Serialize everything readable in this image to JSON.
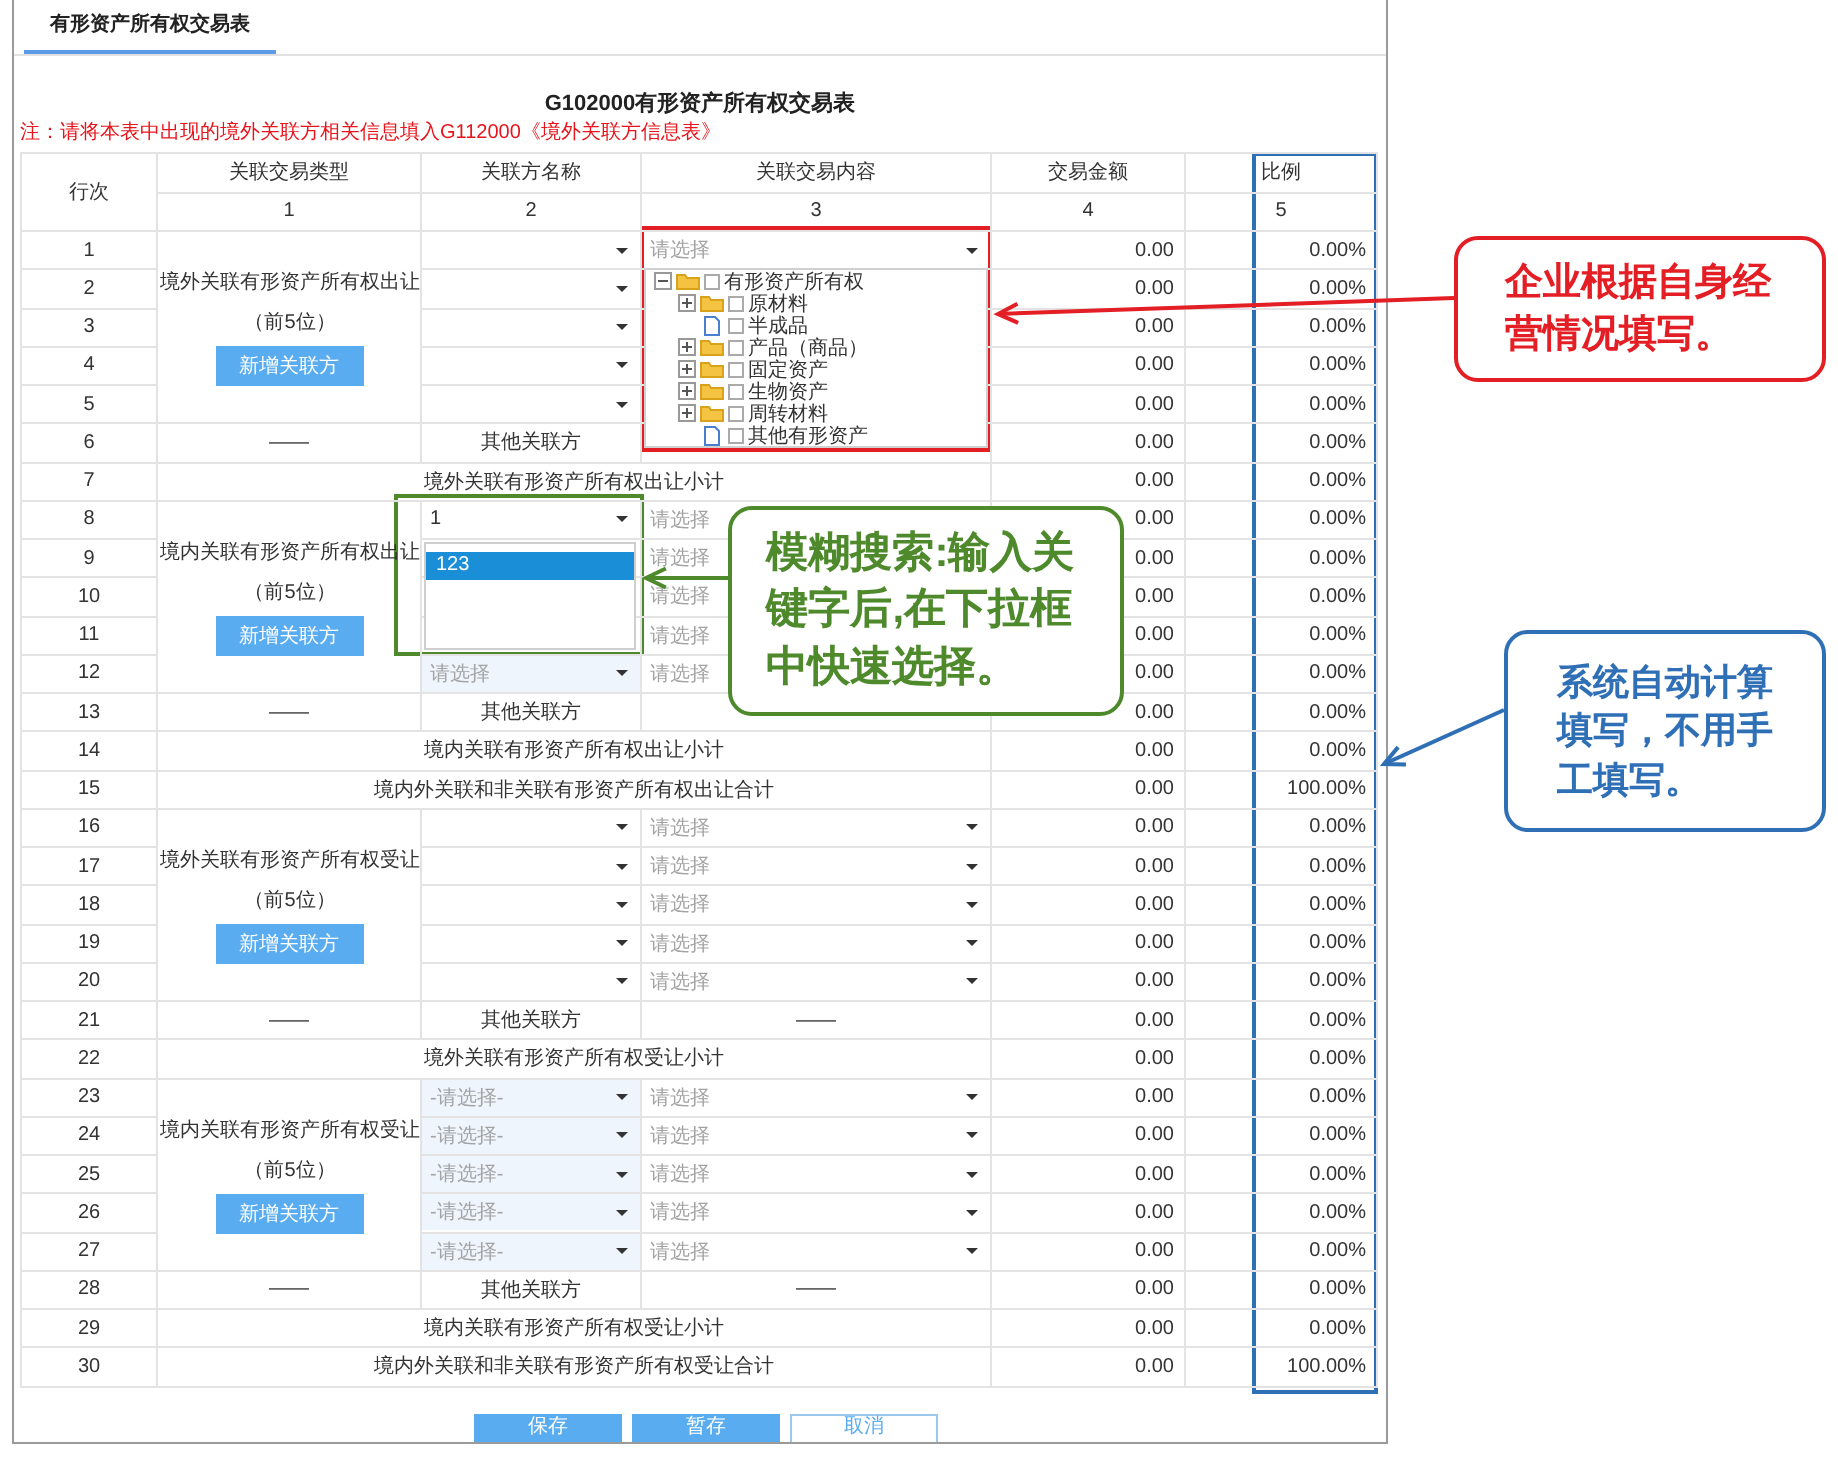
{
  "tab": {
    "label": "有形资产所有权交易表",
    "selected": true
  },
  "title": "G102000有形资产所有权交易表",
  "note": "注：请将本表中出现的境外关联方相关信息填入G112000《境外关联方信息表》",
  "table": {
    "row_no_header": "行次",
    "columns": [
      {
        "label": "关联交易类型",
        "number": "1"
      },
      {
        "label": "关联方名称",
        "number": "2"
      },
      {
        "label": "关联交易内容",
        "number": "3"
      },
      {
        "label": "交易金额",
        "number": "4"
      },
      {
        "label": "比例",
        "number": "5"
      }
    ],
    "sections": [
      {
        "kind": "parties",
        "type_label": "境外关联有形资产所有权出让（前5位）",
        "add_button": "新增关联方",
        "rows": [
          {
            "no": "1",
            "party": {
              "tinted": false,
              "caret": true
            },
            "content": {
              "placeholder": "请选择",
              "caret": true
            },
            "amount": "0.00",
            "ratio": "0.00%"
          },
          {
            "no": "2",
            "party": {
              "tinted": false,
              "caret": true
            },
            "amount": "0.00",
            "ratio": "0.00%"
          },
          {
            "no": "3",
            "party": {
              "tinted": false,
              "caret": true
            },
            "amount": "0.00",
            "ratio": "0.00%"
          },
          {
            "no": "4",
            "party": {
              "tinted": false,
              "caret": true
            },
            "amount": "0.00",
            "ratio": "0.00%"
          },
          {
            "no": "5",
            "party": {
              "tinted": false,
              "caret": true
            },
            "amount": "0.00",
            "ratio": "0.00%"
          }
        ]
      },
      {
        "kind": "other",
        "no": "6",
        "type": "——",
        "party": "其他关联方",
        "amount": "0.00",
        "ratio": "0.00%"
      },
      {
        "kind": "total",
        "no": "7",
        "label": "境外关联有形资产所有权出让小计",
        "amount": "0.00",
        "ratio": "0.00%"
      },
      {
        "kind": "parties",
        "type_label": "境内关联有形资产所有权出让（前5位）",
        "add_button": "新增关联方",
        "rows": [
          {
            "no": "8",
            "party": {
              "value": "1",
              "tinted": false,
              "caret": true
            },
            "content": {
              "placeholder": "请选择",
              "caret": false
            },
            "amount": "0.00",
            "ratio": "0.00%"
          },
          {
            "no": "9",
            "content": {
              "placeholder": "请选择",
              "caret": false
            },
            "amount": "0.00",
            "ratio": "0.00%"
          },
          {
            "no": "10",
            "content": {
              "placeholder": "请选择",
              "caret": false
            },
            "amount": "0.00",
            "ratio": "0.00%"
          },
          {
            "no": "11",
            "content": {
              "placeholder": "请选择",
              "caret": false
            },
            "amount": "0.00",
            "ratio": "0.00%"
          },
          {
            "no": "12",
            "party": {
              "placeholder": "请选择",
              "tinted": true,
              "caret": true
            },
            "content": {
              "placeholder": "请选择",
              "caret": false
            },
            "amount": "0.00",
            "ratio": "0.00%"
          }
        ]
      },
      {
        "kind": "other",
        "no": "13",
        "type": "——",
        "party": "其他关联方",
        "amount": "0.00",
        "ratio": "0.00%"
      },
      {
        "kind": "total",
        "no": "14",
        "label": "境内关联有形资产所有权出让小计",
        "amount": "0.00",
        "ratio": "0.00%"
      },
      {
        "kind": "total",
        "no": "15",
        "label": "境内外关联和非关联有形资产所有权出让合计",
        "amount": "0.00",
        "ratio": "100.00%"
      },
      {
        "kind": "parties",
        "type_label": "境外关联有形资产所有权受让（前5位）",
        "add_button": "新增关联方",
        "rows": [
          {
            "no": "16",
            "party": {
              "tinted": false,
              "caret": true
            },
            "content": {
              "placeholder": "请选择",
              "caret": true
            },
            "amount": "0.00",
            "ratio": "0.00%"
          },
          {
            "no": "17",
            "party": {
              "tinted": false,
              "caret": true
            },
            "content": {
              "placeholder": "请选择",
              "caret": true
            },
            "amount": "0.00",
            "ratio": "0.00%"
          },
          {
            "no": "18",
            "party": {
              "tinted": false,
              "caret": true
            },
            "content": {
              "placeholder": "请选择",
              "caret": true
            },
            "amount": "0.00",
            "ratio": "0.00%"
          },
          {
            "no": "19",
            "party": {
              "tinted": false,
              "caret": true
            },
            "content": {
              "placeholder": "请选择",
              "caret": true
            },
            "amount": "0.00",
            "ratio": "0.00%"
          },
          {
            "no": "20",
            "party": {
              "tinted": false,
              "caret": true
            },
            "content": {
              "placeholder": "请选择",
              "caret": true
            },
            "amount": "0.00",
            "ratio": "0.00%"
          }
        ]
      },
      {
        "kind": "other",
        "no": "21",
        "type": "——",
        "party": "其他关联方",
        "content": "——",
        "amount": "0.00",
        "ratio": "0.00%"
      },
      {
        "kind": "total",
        "no": "22",
        "label": "境外关联有形资产所有权受让小计",
        "amount": "0.00",
        "ratio": "0.00%"
      },
      {
        "kind": "parties",
        "type_label": "境内关联有形资产所有权受让（前5位）",
        "add_button": "新增关联方",
        "rows": [
          {
            "no": "23",
            "party": {
              "placeholder": "-请选择-",
              "tinted": true,
              "caret": true
            },
            "content": {
              "placeholder": "请选择",
              "caret": true
            },
            "amount": "0.00",
            "ratio": "0.00%"
          },
          {
            "no": "24",
            "party": {
              "placeholder": "-请选择-",
              "tinted": true,
              "caret": true
            },
            "content": {
              "placeholder": "请选择",
              "caret": true
            },
            "amount": "0.00",
            "ratio": "0.00%"
          },
          {
            "no": "25",
            "party": {
              "placeholder": "-请选择-",
              "tinted": true,
              "caret": true
            },
            "content": {
              "placeholder": "请选择",
              "caret": true
            },
            "amount": "0.00",
            "ratio": "0.00%"
          },
          {
            "no": "26",
            "party": {
              "placeholder": "-请选择-",
              "tinted": true,
              "caret": true
            },
            "content": {
              "placeholder": "请选择",
              "caret": true
            },
            "amount": "0.00",
            "ratio": "0.00%"
          },
          {
            "no": "27",
            "party": {
              "placeholder": "-请选择-",
              "tinted": true,
              "caret": true
            },
            "content": {
              "placeholder": "请选择",
              "caret": true
            },
            "amount": "0.00",
            "ratio": "0.00%"
          }
        ]
      },
      {
        "kind": "other",
        "no": "28",
        "type": "——",
        "party": "其他关联方",
        "content": "——",
        "amount": "0.00",
        "ratio": "0.00%"
      },
      {
        "kind": "total",
        "no": "29",
        "label": "境内关联有形资产所有权受让小计",
        "amount": "0.00",
        "ratio": "0.00%"
      },
      {
        "kind": "total",
        "no": "30",
        "label": "境内外关联和非关联有形资产所有权受让合计",
        "amount": "0.00",
        "ratio": "100.00%"
      }
    ]
  },
  "tree": {
    "nodes": [
      {
        "label": "有形资产所有权",
        "kind": "folder",
        "expanded": true,
        "checked": false,
        "children": [
          {
            "label": "原材料",
            "kind": "folder",
            "expanded": false,
            "checked": false
          },
          {
            "label": "半成品",
            "kind": "leaf",
            "checked": false
          },
          {
            "label": "产品（商品）",
            "kind": "folder",
            "expanded": false,
            "checked": false
          },
          {
            "label": "固定资产",
            "kind": "folder",
            "expanded": false,
            "checked": false
          },
          {
            "label": "生物资产",
            "kind": "folder",
            "expanded": false,
            "checked": false
          },
          {
            "label": "周转材料",
            "kind": "folder",
            "expanded": false,
            "checked": false
          },
          {
            "label": "其他有形资产",
            "kind": "leaf",
            "checked": false
          }
        ]
      }
    ]
  },
  "suggestions": {
    "options": [
      {
        "label": "123",
        "selected": true
      }
    ]
  },
  "buttons": [
    {
      "label": "保存",
      "kind": "primary"
    },
    {
      "label": "暂存",
      "kind": "primary"
    },
    {
      "label": "取消",
      "kind": "secondary"
    }
  ],
  "callouts": [
    {
      "text": "企业根据自身经营情况填写。",
      "color": "#e31e24"
    },
    {
      "text": "模糊搜索:输入关键字后,在下拉框中快速选择。",
      "color": "#4e8a2c"
    },
    {
      "text": "系统自动计算填写，不用手工填写。",
      "color": "#2f6fb6"
    }
  ]
}
